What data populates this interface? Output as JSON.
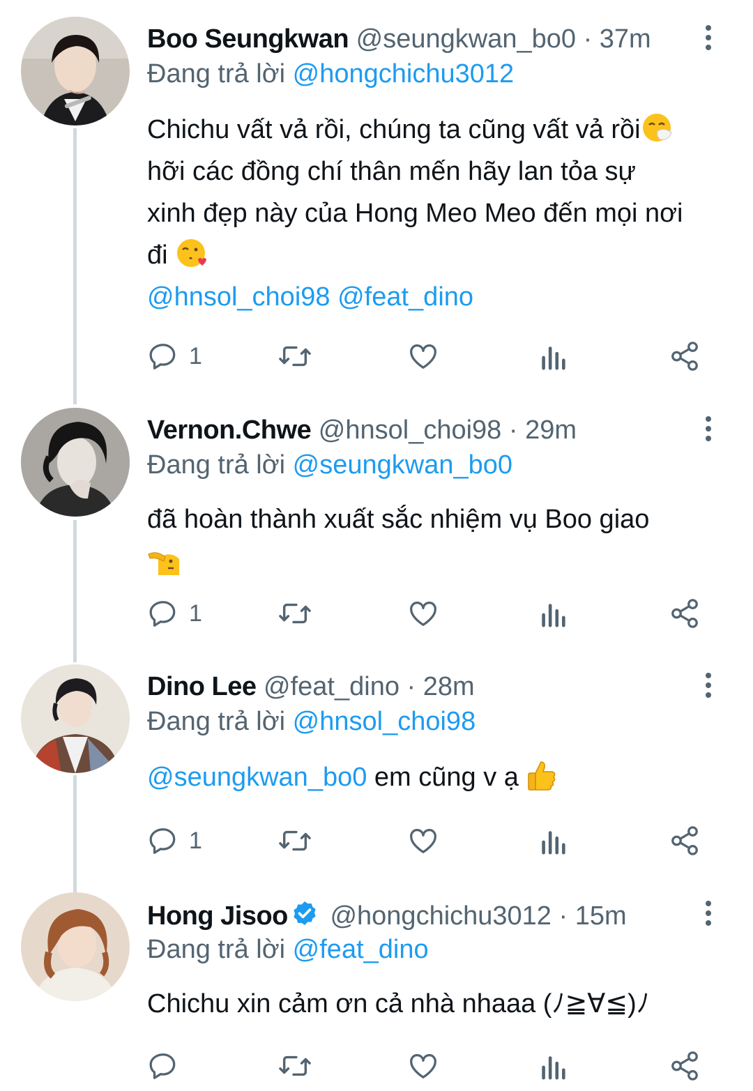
{
  "reply_prefix": "Đang trả lời",
  "tweets": [
    {
      "name": "Boo Seungkwan",
      "handle": "@seungkwan_bo0",
      "dot": "·",
      "time": "37m",
      "replying_to": "@hongchichu3012",
      "body_lines": [
        "Chichu vất vả rồi, chúng ta cũng vất vả rồi",
        "hỡi các đồng chí thân mến hãy lan tỏa sự",
        "xinh đẹp này của Hong Meo Meo đến mọi nơi",
        "đi"
      ],
      "emojis": [
        "sneezing-face-emoji",
        "face-blowing-kiss-emoji"
      ],
      "mentions_line": [
        "@hnsol_choi98",
        "@feat_dino"
      ],
      "reply_count": "1"
    },
    {
      "name": "Vernon.Chwe",
      "handle": "@hnsol_choi98",
      "dot": "·",
      "time": "29m",
      "replying_to": "@seungkwan_bo0",
      "body_lines": [
        "đã hoàn thành xuất sắc nhiệm vụ Boo giao"
      ],
      "emojis": [
        "saluting-face-emoji"
      ],
      "reply_count": "1"
    },
    {
      "name": "Dino Lee",
      "handle": "@feat_dino",
      "dot": "·",
      "time": "28m",
      "replying_to": "@hnsol_choi98",
      "body_mention": "@seungkwan_bo0",
      "body_text": "em cũng v ạ",
      "emojis": [
        "thumbs-up-emoji"
      ],
      "reply_count": "1"
    },
    {
      "name": "Hong Jisoo",
      "verified": true,
      "handle": "@hongchichu3012",
      "dot": "·",
      "time": "15m",
      "replying_to": "@feat_dino",
      "body_lines": [
        "Chichu xin cảm ơn cả nhà nhaaa (ﾉ≧∀≦)ﾉ"
      ],
      "reply_count": ""
    }
  ],
  "colors": {
    "text": "#0f1419",
    "secondary": "#536471",
    "link": "#1d9bf0",
    "thread_line": "#cfd9de"
  },
  "icons": [
    "reply-icon",
    "retweet-icon",
    "like-icon",
    "views-icon",
    "share-icon",
    "more-icon",
    "verified-badge-icon"
  ]
}
